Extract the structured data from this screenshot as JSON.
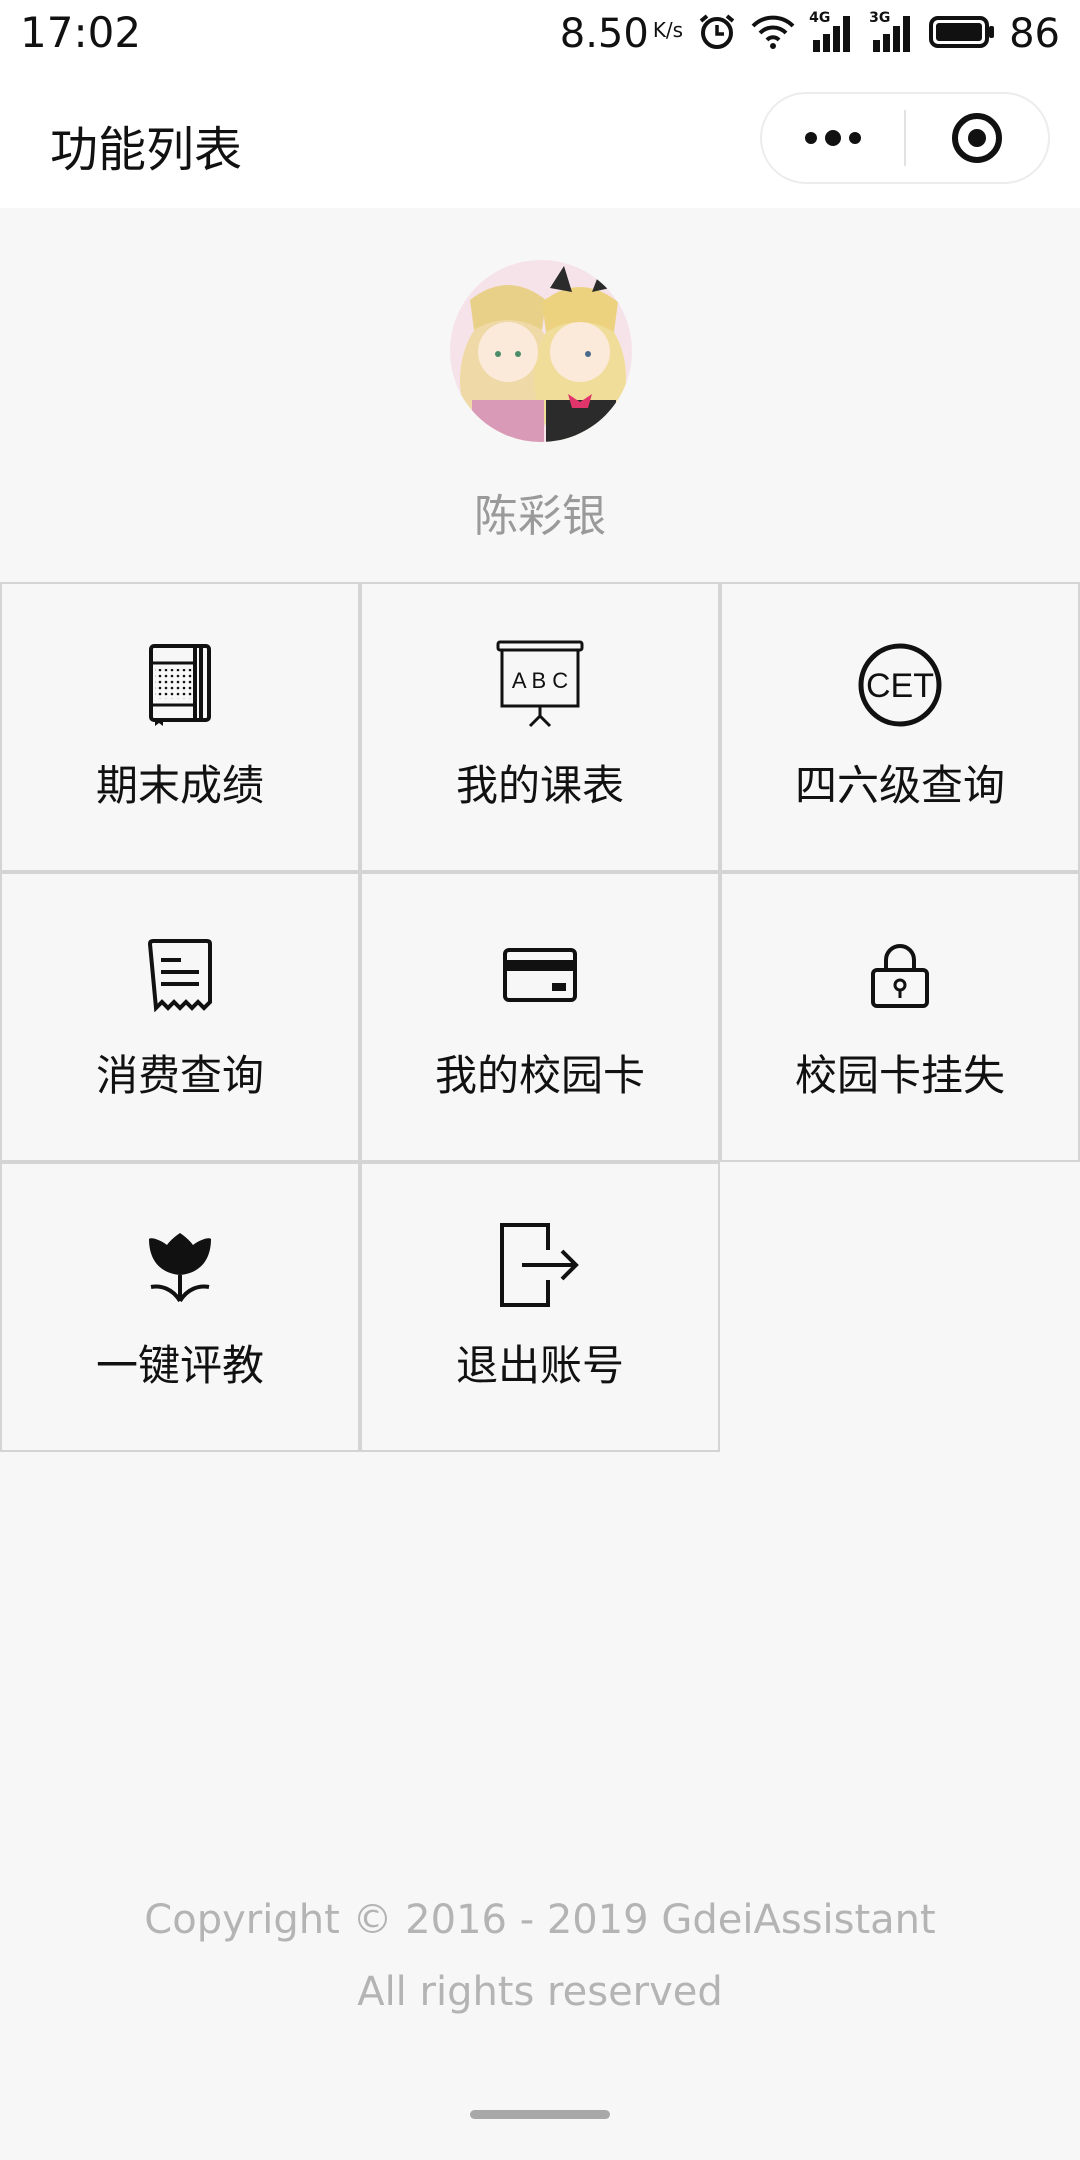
{
  "status_bar": {
    "time": "17:02",
    "net_speed": "8.50",
    "net_unit": "K/s",
    "signal_4g_label": "4G",
    "signal_3g_label": "3G",
    "battery": "86"
  },
  "nav": {
    "title": "功能列表"
  },
  "profile": {
    "name": "陈彩银"
  },
  "menu": [
    {
      "label": "期末成绩",
      "icon": "notebook-icon"
    },
    {
      "label": "我的课表",
      "icon": "abc-board-icon"
    },
    {
      "label": "四六级查询",
      "icon": "cet-icon",
      "icon_text": "CET"
    },
    {
      "label": "消费查询",
      "icon": "receipt-icon"
    },
    {
      "label": "我的校园卡",
      "icon": "credit-card-icon"
    },
    {
      "label": "校园卡挂失",
      "icon": "lock-icon"
    },
    {
      "label": "一键评教",
      "icon": "tulip-icon"
    },
    {
      "label": "退出账号",
      "icon": "logout-icon"
    }
  ],
  "footer": {
    "line1": "Copyright © 2016 - 2019 GdeiAssistant",
    "line2": "All rights reserved"
  },
  "colors": {
    "background": "#f7f7f7",
    "grid_border": "#d4d4d4",
    "name_text": "#9a9a9a",
    "footer_text": "#b4b4b4"
  }
}
